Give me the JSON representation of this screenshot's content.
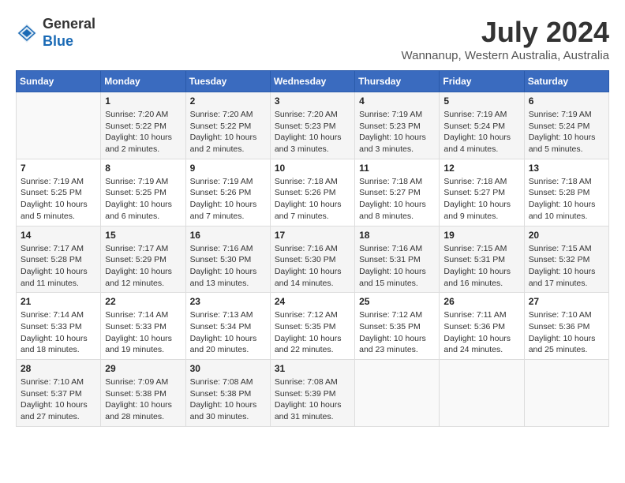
{
  "header": {
    "logo_line1": "General",
    "logo_line2": "Blue",
    "month_title": "July 2024",
    "location": "Wannanup, Western Australia, Australia"
  },
  "days_of_week": [
    "Sunday",
    "Monday",
    "Tuesday",
    "Wednesday",
    "Thursday",
    "Friday",
    "Saturday"
  ],
  "weeks": [
    [
      {
        "day": "",
        "info": ""
      },
      {
        "day": "1",
        "info": "Sunrise: 7:20 AM\nSunset: 5:22 PM\nDaylight: 10 hours\nand 2 minutes."
      },
      {
        "day": "2",
        "info": "Sunrise: 7:20 AM\nSunset: 5:22 PM\nDaylight: 10 hours\nand 2 minutes."
      },
      {
        "day": "3",
        "info": "Sunrise: 7:20 AM\nSunset: 5:23 PM\nDaylight: 10 hours\nand 3 minutes."
      },
      {
        "day": "4",
        "info": "Sunrise: 7:19 AM\nSunset: 5:23 PM\nDaylight: 10 hours\nand 3 minutes."
      },
      {
        "day": "5",
        "info": "Sunrise: 7:19 AM\nSunset: 5:24 PM\nDaylight: 10 hours\nand 4 minutes."
      },
      {
        "day": "6",
        "info": "Sunrise: 7:19 AM\nSunset: 5:24 PM\nDaylight: 10 hours\nand 5 minutes."
      }
    ],
    [
      {
        "day": "7",
        "info": "Sunrise: 7:19 AM\nSunset: 5:25 PM\nDaylight: 10 hours\nand 5 minutes."
      },
      {
        "day": "8",
        "info": "Sunrise: 7:19 AM\nSunset: 5:25 PM\nDaylight: 10 hours\nand 6 minutes."
      },
      {
        "day": "9",
        "info": "Sunrise: 7:19 AM\nSunset: 5:26 PM\nDaylight: 10 hours\nand 7 minutes."
      },
      {
        "day": "10",
        "info": "Sunrise: 7:18 AM\nSunset: 5:26 PM\nDaylight: 10 hours\nand 7 minutes."
      },
      {
        "day": "11",
        "info": "Sunrise: 7:18 AM\nSunset: 5:27 PM\nDaylight: 10 hours\nand 8 minutes."
      },
      {
        "day": "12",
        "info": "Sunrise: 7:18 AM\nSunset: 5:27 PM\nDaylight: 10 hours\nand 9 minutes."
      },
      {
        "day": "13",
        "info": "Sunrise: 7:18 AM\nSunset: 5:28 PM\nDaylight: 10 hours\nand 10 minutes."
      }
    ],
    [
      {
        "day": "14",
        "info": "Sunrise: 7:17 AM\nSunset: 5:28 PM\nDaylight: 10 hours\nand 11 minutes."
      },
      {
        "day": "15",
        "info": "Sunrise: 7:17 AM\nSunset: 5:29 PM\nDaylight: 10 hours\nand 12 minutes."
      },
      {
        "day": "16",
        "info": "Sunrise: 7:16 AM\nSunset: 5:30 PM\nDaylight: 10 hours\nand 13 minutes."
      },
      {
        "day": "17",
        "info": "Sunrise: 7:16 AM\nSunset: 5:30 PM\nDaylight: 10 hours\nand 14 minutes."
      },
      {
        "day": "18",
        "info": "Sunrise: 7:16 AM\nSunset: 5:31 PM\nDaylight: 10 hours\nand 15 minutes."
      },
      {
        "day": "19",
        "info": "Sunrise: 7:15 AM\nSunset: 5:31 PM\nDaylight: 10 hours\nand 16 minutes."
      },
      {
        "day": "20",
        "info": "Sunrise: 7:15 AM\nSunset: 5:32 PM\nDaylight: 10 hours\nand 17 minutes."
      }
    ],
    [
      {
        "day": "21",
        "info": "Sunrise: 7:14 AM\nSunset: 5:33 PM\nDaylight: 10 hours\nand 18 minutes."
      },
      {
        "day": "22",
        "info": "Sunrise: 7:14 AM\nSunset: 5:33 PM\nDaylight: 10 hours\nand 19 minutes."
      },
      {
        "day": "23",
        "info": "Sunrise: 7:13 AM\nSunset: 5:34 PM\nDaylight: 10 hours\nand 20 minutes."
      },
      {
        "day": "24",
        "info": "Sunrise: 7:12 AM\nSunset: 5:35 PM\nDaylight: 10 hours\nand 22 minutes."
      },
      {
        "day": "25",
        "info": "Sunrise: 7:12 AM\nSunset: 5:35 PM\nDaylight: 10 hours\nand 23 minutes."
      },
      {
        "day": "26",
        "info": "Sunrise: 7:11 AM\nSunset: 5:36 PM\nDaylight: 10 hours\nand 24 minutes."
      },
      {
        "day": "27",
        "info": "Sunrise: 7:10 AM\nSunset: 5:36 PM\nDaylight: 10 hours\nand 25 minutes."
      }
    ],
    [
      {
        "day": "28",
        "info": "Sunrise: 7:10 AM\nSunset: 5:37 PM\nDaylight: 10 hours\nand 27 minutes."
      },
      {
        "day": "29",
        "info": "Sunrise: 7:09 AM\nSunset: 5:38 PM\nDaylight: 10 hours\nand 28 minutes."
      },
      {
        "day": "30",
        "info": "Sunrise: 7:08 AM\nSunset: 5:38 PM\nDaylight: 10 hours\nand 30 minutes."
      },
      {
        "day": "31",
        "info": "Sunrise: 7:08 AM\nSunset: 5:39 PM\nDaylight: 10 hours\nand 31 minutes."
      },
      {
        "day": "",
        "info": ""
      },
      {
        "day": "",
        "info": ""
      },
      {
        "day": "",
        "info": ""
      }
    ]
  ]
}
